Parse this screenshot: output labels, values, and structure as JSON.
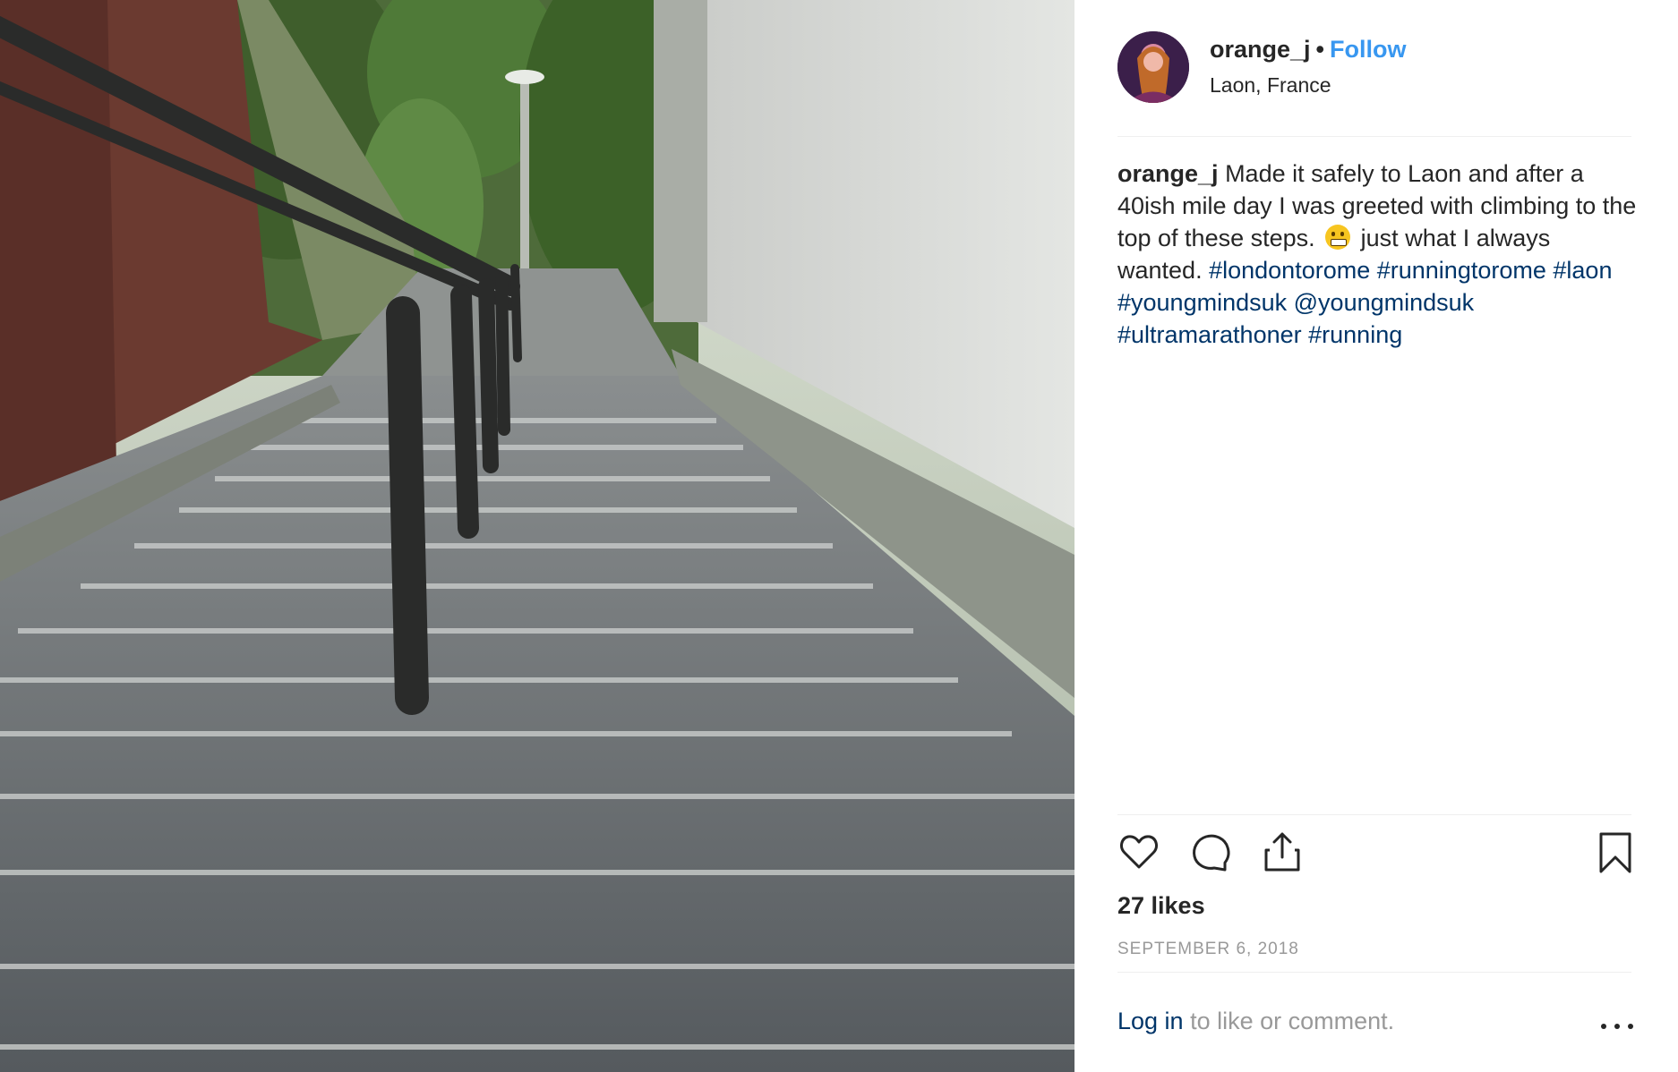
{
  "post": {
    "username": "orange_j",
    "separator": "•",
    "follow_label": "Follow",
    "location": "Laon, France",
    "caption": {
      "username": "orange_j",
      "text_1": "Made it safely to Laon and after a 40ish mile day I was greeted with climbing to the top of these steps.",
      "emoji": "grimacing-face",
      "text_2": "just what I always wanted.",
      "tags": [
        "#londontorome",
        "#runningtorome",
        "#laon",
        "#youngmindsuk",
        "@youngmindsuk",
        "#ultramarathoner",
        "#running"
      ]
    },
    "likes": "27 likes",
    "date": "SEPTEMBER 6, 2018",
    "login_link": "Log in",
    "login_suffix": "to like or comment."
  },
  "icons": {
    "like": "heart-icon",
    "comment": "comment-bubble-icon",
    "share": "share-icon",
    "save": "bookmark-icon",
    "more": "more-options-icon"
  },
  "colors": {
    "follow": "#3897f0",
    "link": "#003569",
    "muted": "#999999",
    "text": "#262626"
  }
}
